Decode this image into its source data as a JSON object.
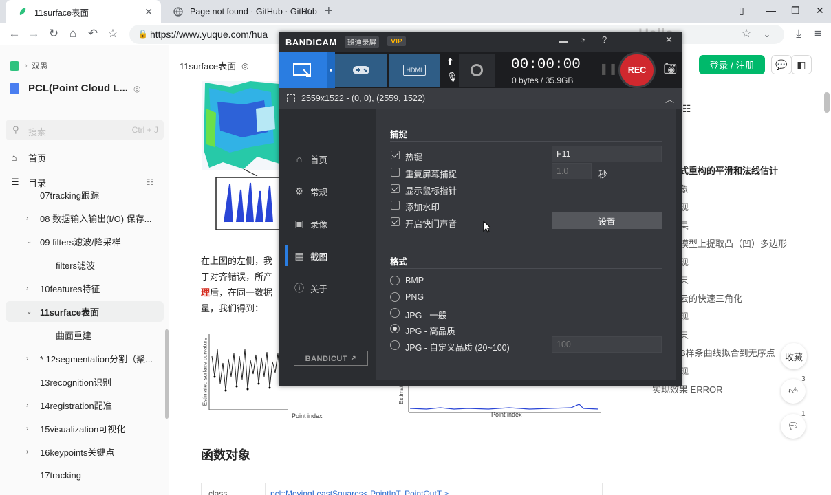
{
  "browser": {
    "tabs": [
      {
        "title": "11surface表面",
        "close": "✕"
      },
      {
        "title": "Page not found · GitHub · GitHub",
        "close": "✕"
      }
    ],
    "new_tab": "+",
    "url": "https://www.yuque.com/hua",
    "overlay_text": "--Hello"
  },
  "sidebar": {
    "breadcrumb": "双愚",
    "book_title": "PCL(Point Cloud L...",
    "search_placeholder": "搜索",
    "search_shortcut": "Ctrl + J",
    "home": "首页",
    "toc_label": "目录",
    "items": [
      {
        "label": "07tracking跟踪"
      },
      {
        "label": "08 数据输入输出(I/O) 保存..."
      },
      {
        "label": "09 filters滤波/降采样"
      },
      {
        "label": "filters滤波"
      },
      {
        "label": "10features特征"
      },
      {
        "label": "11surface表面"
      },
      {
        "label": "曲面重建"
      },
      {
        "label": "* 12segmentation分割（聚..."
      },
      {
        "label": "13recognition识别"
      },
      {
        "label": "14registration配准"
      },
      {
        "label": "15visualization可视化"
      },
      {
        "label": "16keypoints关键点"
      },
      {
        "label": "17tracking"
      }
    ]
  },
  "doc": {
    "crumb_title": "11surface表面",
    "login_button": "登录 / 注册",
    "para_line1": "在上图的左侧，我",
    "para_line2": "于对齐错误，所产",
    "para_line3_bold": "理",
    "para_line3_rest": "后，在同一数据",
    "para_line4": "量，我们得到：",
    "plot_ylabel1": "Estimated surface curvature",
    "plot_xlabel1": "Point index",
    "plot_ylabel2": "Estimat",
    "plot_xlabel2": "Point index",
    "section_heading": "函数对象",
    "table_class": "class",
    "table_sig": "pcl::MovingLeastSquares< PointInT, PointOutT >"
  },
  "toc": {
    "items": [
      {
        "label": "式重构的平滑和法线估计",
        "bold": true
      },
      {
        "label": "象"
      },
      {
        "label": "现"
      },
      {
        "label": "果"
      },
      {
        "label": "模型上提取凸（凹）多边形"
      },
      {
        "label": "现"
      },
      {
        "label": "果"
      },
      {
        "label": "云的快速三角化"
      },
      {
        "label": "现"
      },
      {
        "label": "果"
      },
      {
        "label": "B样条曲线拟合到无序点"
      },
      {
        "label": "现"
      },
      {
        "label": "实现效果 ERROR"
      }
    ]
  },
  "float": {
    "collect": "收藏",
    "like_count": "3",
    "comment_count": "1"
  },
  "bandicam": {
    "brand": "BANDICAM",
    "brand_cn": "班迪录屏",
    "vip": "VIP",
    "hdmi": "HDMI",
    "timer": "00:00:00",
    "size": "0 bytes / 35.9GB",
    "rec": "REC",
    "resolution": "2559x1522 - (0, 0), (2559, 1522)",
    "nav": [
      {
        "label": "首页",
        "icon": "home-icon"
      },
      {
        "label": "常规",
        "icon": "gear-icon"
      },
      {
        "label": "录像",
        "icon": "video-icon"
      },
      {
        "label": "截图",
        "icon": "image-icon"
      },
      {
        "label": "关于",
        "icon": "info-icon"
      }
    ],
    "bandicut": "BANDICUT ↗",
    "capture": {
      "title": "捕捉",
      "hotkey_label": "热键",
      "hotkey_value": "F11",
      "repeat_label": "重复屏幕捕捉",
      "repeat_value": "1.0",
      "seconds": "秒",
      "cursor_label": "显示鼠标指针",
      "watermark_label": "添加水印",
      "shutter_label": "开启快门声音",
      "settings_button": "设置"
    },
    "format": {
      "title": "格式",
      "options": [
        "BMP",
        "PNG",
        "JPG - 一般",
        "JPG - 高品质",
        "JPG - 自定义品质 (20~100)"
      ],
      "selected": "JPG - 高品质",
      "quality_value": "100"
    }
  }
}
